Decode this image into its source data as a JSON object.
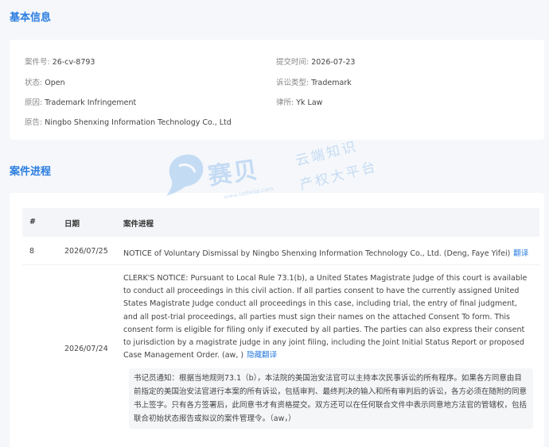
{
  "basic_info": {
    "title": "基本信息",
    "case_no_label": "案件号:",
    "case_no": "26-cv-8793",
    "submit_time_label": "提交时间:",
    "submit_time": "2026-07-23",
    "status_label": "状态:",
    "status": "Open",
    "litigation_type_label": "诉讼类型:",
    "litigation_type": "Trademark",
    "plaintiff_label": "原因:",
    "plaintiff": "Trademark Infringement",
    "law_firm_label": "律所:",
    "law_firm": "Yk Law",
    "defendant_label": "原告:",
    "defendant": "Ningbo Shenxing Information Technology Co., Ltd"
  },
  "progress": {
    "title": "案件进程",
    "headers": {
      "num": "#",
      "date": "日期",
      "progress": "案件进程"
    },
    "rows": [
      {
        "num": "8",
        "date": "2026/07/25",
        "text": "NOTICE of Voluntary Dismissal by Ningbo Shenxing Information Technology Co., Ltd. (Deng, Faye Yifei)",
        "action": "翻译"
      },
      {
        "num": "",
        "date": "2026/07/24",
        "text": "CLERK'S NOTICE: Pursuant to Local Rule 73.1(b), a United States Magistrate Judge of this court is available to conduct all proceedings in this civil action. If all parties consent to have the currently assigned United States Magistrate Judge conduct all proceedings in this case, including trial, the entry of final judgment, and all post-trial proceedings, all parties must sign their names on the attached Consent To form. This consent form is eligible for filing only if executed by all parties. The parties can also express their consent to jurisdiction by a magistrate judge in any joint filing, including the Joint Initial Status Report or proposed Case Management Order. (aw, )",
        "action": "隐藏翻译",
        "translation": "书记员通知：根据当地规则73.1（b），本法院的美国治安法官可以主持本次民事诉讼的所有程序。如果各方同意由目前指定的美国治安法官进行本案的所有诉讼，包括审判、最终判决的输入和所有审判后的诉讼，各方必须在随附的同意书上签字。只有各方签署后，此同意书才有资格提交。双方还可以在任何联合文件中表示同意地方法官的管辖权，包括联合初始状态报告或拟议的案件管理令。（aw，）"
      }
    ]
  },
  "watermark": {
    "brand": "赛贝",
    "slogan_1": "云端知识",
    "slogan_2": "产权大平台",
    "url": "www.saibeiip.com"
  }
}
